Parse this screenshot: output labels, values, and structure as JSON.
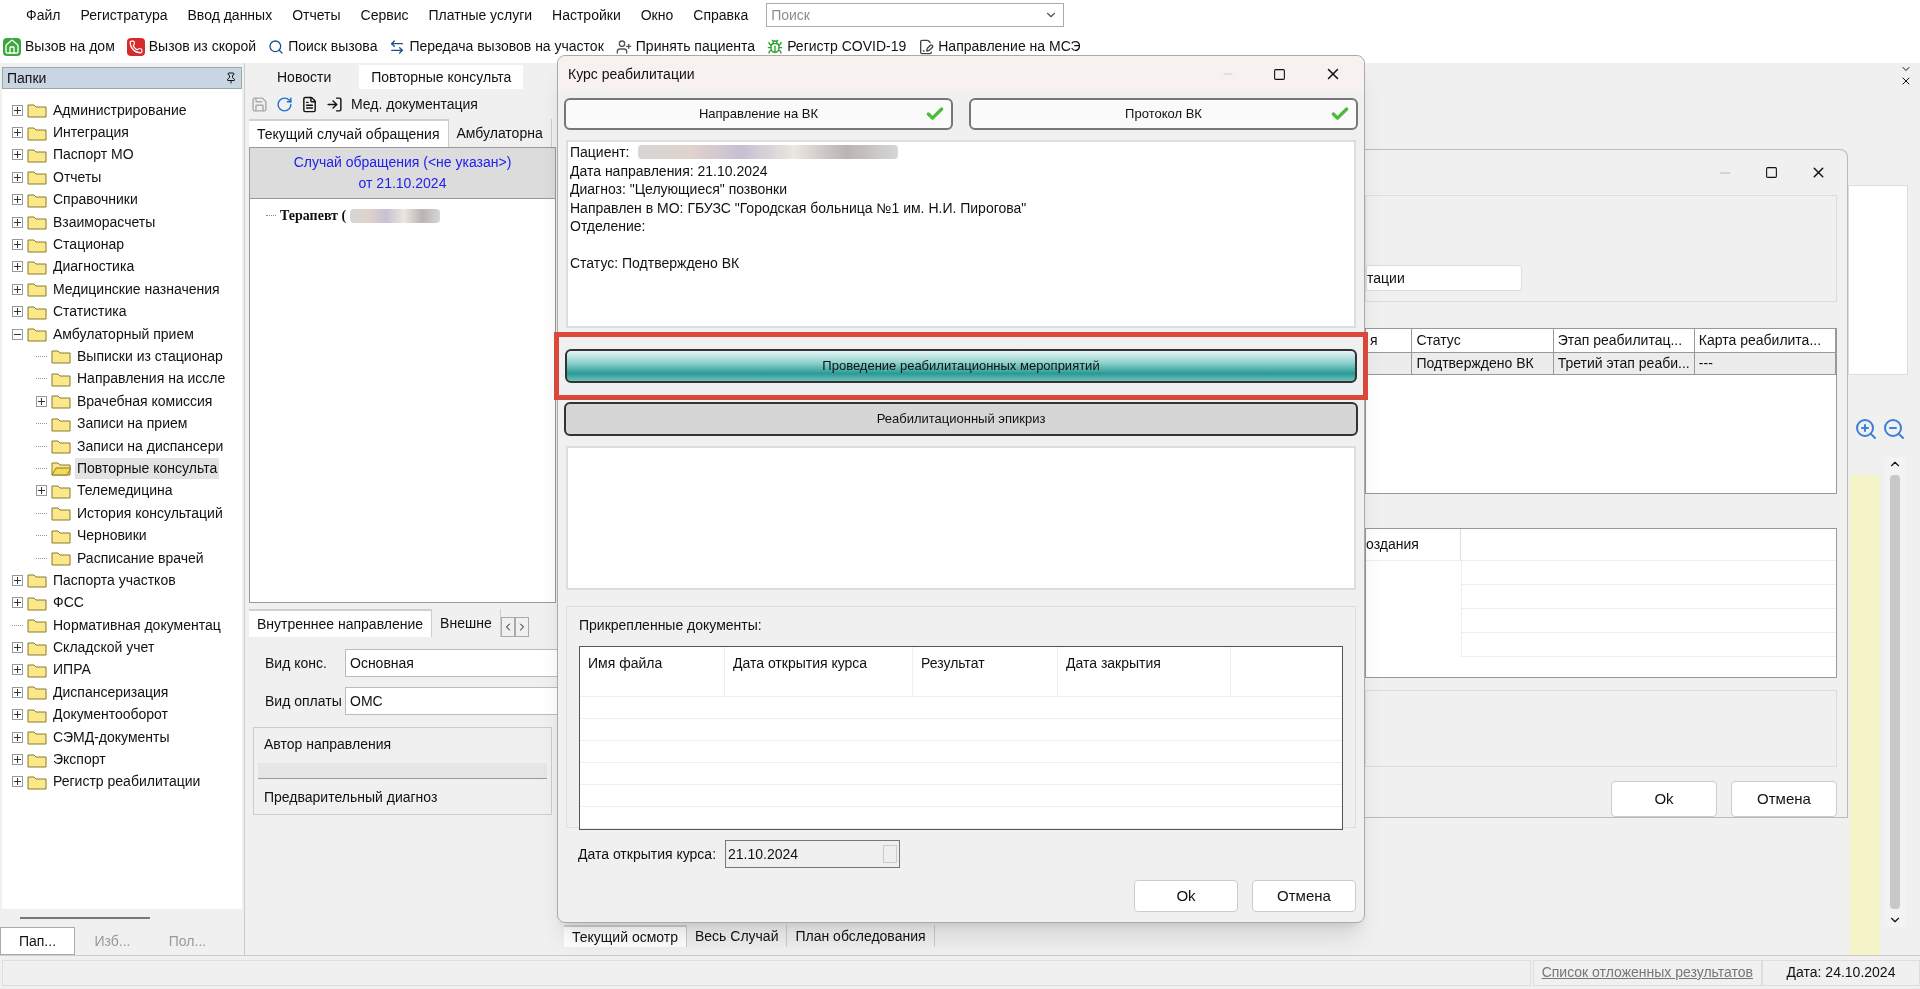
{
  "menu": [
    "Файл",
    "Регистратура",
    "Ввод данных",
    "Отчеты",
    "Сервис",
    "Платные услуги",
    "Настройки",
    "Окно",
    "Справка"
  ],
  "search": {
    "placeholder": "Поиск"
  },
  "toolbar": [
    {
      "kind": "home",
      "label": "Вызов на дом"
    },
    {
      "kind": "ambulance",
      "label": "Вызов из скорой"
    },
    {
      "kind": "search",
      "label": "Поиск вызова"
    },
    {
      "kind": "transfer",
      "label": "Передача вызовов на участок"
    },
    {
      "kind": "patient",
      "label": "Принять пациента"
    },
    {
      "kind": "virus",
      "label": "Регистр COVID-19"
    },
    {
      "kind": "referral",
      "label": "Направление на МСЭ"
    }
  ],
  "folders": {
    "title": "Папки",
    "items": [
      {
        "label": "Администрирование",
        "expanded": false,
        "selected": false
      },
      {
        "label": "Интеграция",
        "expanded": false,
        "selected": false
      },
      {
        "label": "Паспорт МО",
        "expanded": false,
        "selected": false
      },
      {
        "label": "Отчеты",
        "expanded": false,
        "selected": false
      },
      {
        "label": "Справочники",
        "expanded": false,
        "selected": false
      },
      {
        "label": "Взаиморасчеты",
        "expanded": false,
        "selected": false
      },
      {
        "label": "Стационар",
        "expanded": false,
        "selected": false
      },
      {
        "label": "Диагностика",
        "expanded": false,
        "selected": false
      },
      {
        "label": "Медицинские назначения",
        "expanded": false,
        "selected": false
      },
      {
        "label": "Статистика",
        "expanded": false,
        "selected": false
      },
      {
        "label": "Амбулаторный прием",
        "expanded": true,
        "selected": false,
        "children": [
          {
            "label": "Выписки из стационар",
            "selected": false
          },
          {
            "label": "Направления на иссле",
            "selected": false
          },
          {
            "label": "Врачебная комиссия",
            "expanded": false,
            "selected": false
          },
          {
            "label": "Записи на прием",
            "selected": false
          },
          {
            "label": "Записи на диспансери",
            "selected": false
          },
          {
            "label": "Повторные консульта",
            "selected": true
          },
          {
            "label": "Телемедицина",
            "expanded": false,
            "selected": false
          },
          {
            "label": "История консультаций",
            "selected": false
          },
          {
            "label": "Черновики",
            "selected": false
          },
          {
            "label": "Расписание врачей",
            "selected": false
          }
        ]
      },
      {
        "label": "Паспорта участков",
        "expanded": false,
        "selected": false
      },
      {
        "label": "ФСС",
        "expanded": false,
        "selected": false
      },
      {
        "label": "Нормативная документац",
        "selected": false
      },
      {
        "label": "Складской учет",
        "expanded": false,
        "selected": false
      },
      {
        "label": "ИПРА",
        "expanded": false,
        "selected": false
      },
      {
        "label": "Диспансеризация",
        "expanded": false,
        "selected": false
      },
      {
        "label": "Документооборот",
        "expanded": false,
        "selected": false
      },
      {
        "label": "СЭМД-документы",
        "expanded": false,
        "selected": false
      },
      {
        "label": "Экспорт",
        "expanded": false,
        "selected": false
      },
      {
        "label": "Регистр реабилитации",
        "expanded": false,
        "selected": false
      }
    ],
    "tabs": [
      {
        "label": "Пап...",
        "selected": true
      },
      {
        "label": "Изб...",
        "selected": false
      },
      {
        "label": "Пол...",
        "selected": false
      }
    ]
  },
  "doc_tabs": [
    {
      "label": "Новости",
      "selected": false
    },
    {
      "label": "Повторные консульта",
      "selected": true
    }
  ],
  "doc_toolbar": {
    "label": "Мед. документация"
  },
  "case_tabs": [
    {
      "label": "Текущий случай обращения",
      "selected": true
    },
    {
      "label": "Амбулаторна",
      "selected": false
    }
  ],
  "case": {
    "title": "Случай обращения (<не указан>)",
    "date": "от 21.10.2024",
    "entry": "Терапевт ("
  },
  "referral_tabs": [
    {
      "label": "Внутреннее направление",
      "selected": true
    },
    {
      "label": "Внешне",
      "selected": false
    }
  ],
  "referral_fields": [
    {
      "label": "Вид конс.",
      "value": "Основная"
    },
    {
      "label": "Вид оплаты",
      "value": "ОМС"
    }
  ],
  "referral_sections": [
    "Автор направления",
    "Предварительный диагноз"
  ],
  "exam_tabs": [
    {
      "label": "Текущий осмотр",
      "selected": true
    },
    {
      "label": "Весь Случай",
      "selected": false
    },
    {
      "label": "План обследования",
      "selected": false
    }
  ],
  "dialog": {
    "title": "Курс реабилитации",
    "approvals": [
      {
        "label": "Направление на ВК",
        "done": true
      },
      {
        "label": "Протокол ВК",
        "done": true
      }
    ],
    "patient_label": "Пациент:",
    "info": [
      "Дата направления: 21.10.2024",
      "Диагноз: \"Целующиеся\" позвонки",
      "Направлен в МО: ГБУЗС \"Городская больница №1 им. Н.И. Пирогова\"",
      "Отделение:"
    ],
    "status": "Статус: Подтверждено ВК",
    "steps": [
      {
        "label": "Проведение реабилитационных мероприятий",
        "selected": true,
        "highlighted": true
      },
      {
        "label": "Реабилитационный эпикриз",
        "selected": false,
        "highlighted": false
      }
    ],
    "documents": {
      "title": "Прикрепленные документы:",
      "columns": [
        "Имя файла",
        "Дата открытия курса",
        "Результат",
        "Дата закрытия"
      ]
    },
    "open_date": {
      "label": "Дата открытия курса:",
      "value": "21.10.2024"
    },
    "buttons": [
      "Ok",
      "Отмена"
    ]
  },
  "back_dialog": {
    "field": "тации",
    "columns": [
      "я",
      "Статус",
      "Этап реабилитац...",
      "Карта реабилита..."
    ],
    "rows": [
      {
        "cells": [
          "",
          "Подтверждено ВК",
          "Третий этап реаби...",
          "---"
        ],
        "selected": true
      }
    ],
    "table2_column": "оздания",
    "buttons": [
      "Ok",
      "Отмена"
    ]
  },
  "status_bar": {
    "link": "Список отложенных результатов",
    "date": "Дата: 24.10.2024"
  }
}
